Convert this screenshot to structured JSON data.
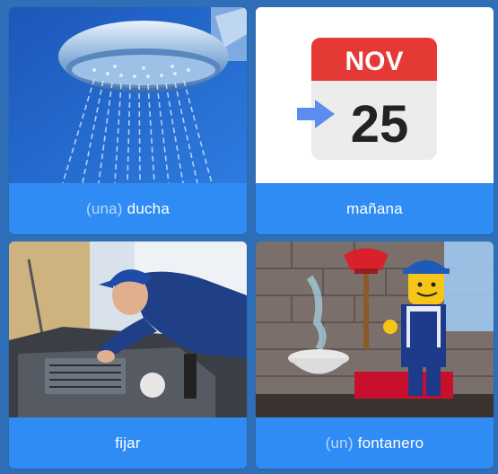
{
  "cards": [
    {
      "article": "(una)",
      "word": "ducha",
      "image": "shower-head-image"
    },
    {
      "article": "",
      "word": "mañana",
      "image": "calendar-tomorrow-image",
      "calendar": {
        "month": "NOV",
        "day": "25"
      }
    },
    {
      "article": "",
      "word": "fijar",
      "image": "mechanic-fixing-car-image"
    },
    {
      "article": "(un)",
      "word": "fontanero",
      "image": "toy-plumber-image"
    }
  ],
  "colors": {
    "background": "#2f6fb8",
    "card_label": "#2f8cf4",
    "article_text": "#bcd7fb",
    "calendar_red": "#e53935",
    "calendar_arrow": "#5b8def"
  }
}
